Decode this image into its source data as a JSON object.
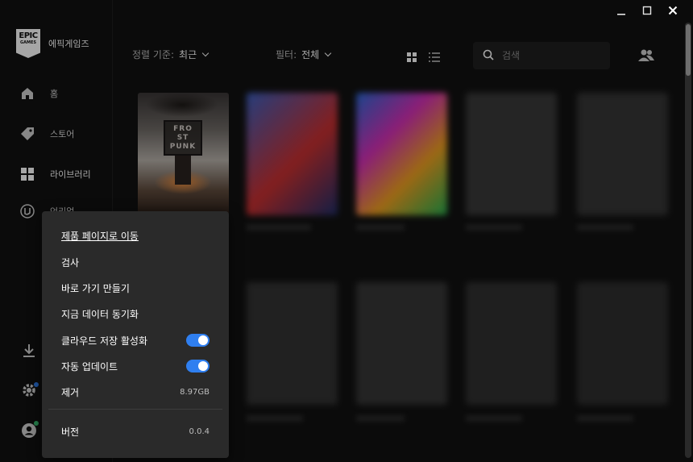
{
  "window": {
    "minimize": "—",
    "maximize": "☐",
    "close": "✕"
  },
  "sidebar": {
    "brand_logo_l1": "EPIC",
    "brand_logo_l2": "GAMES",
    "brand_name": "에픽게임즈",
    "items": [
      {
        "label": "홈",
        "icon": "home-icon"
      },
      {
        "label": "스토어",
        "icon": "tag-icon"
      },
      {
        "label": "라이브러리",
        "icon": "grid-icon"
      },
      {
        "label": "언리얼",
        "icon": "unreal-icon"
      }
    ],
    "bottom_icons": [
      "download-icon",
      "settings-icon",
      "profile-icon"
    ]
  },
  "toolbar": {
    "sort_label": "정렬 기준:",
    "sort_value": "최근",
    "filter_label": "필터:",
    "filter_value": "전체",
    "view_modes": [
      "grid-view-icon",
      "list-view-icon"
    ],
    "search_placeholder": "검색"
  },
  "library": {
    "featured_game_title_lines": [
      "FRO",
      "ST",
      "PUNK"
    ]
  },
  "context_menu": {
    "items": [
      {
        "label": "제품 페이지로 이동"
      },
      {
        "label": "검사"
      },
      {
        "label": "바로 가기 만들기"
      },
      {
        "label": "지금 데이터 동기화"
      },
      {
        "label": "클라우드 저장 활성화",
        "toggle": true
      },
      {
        "label": "자동 업데이트",
        "toggle": true
      },
      {
        "label": "제거",
        "value": "8.97GB"
      }
    ],
    "version_label": "버전",
    "version_value": "0.0.4"
  },
  "colors": {
    "accent": "#2f7ff0",
    "background": "#121212",
    "menu": "#2a2a2a",
    "online": "#38c172"
  }
}
